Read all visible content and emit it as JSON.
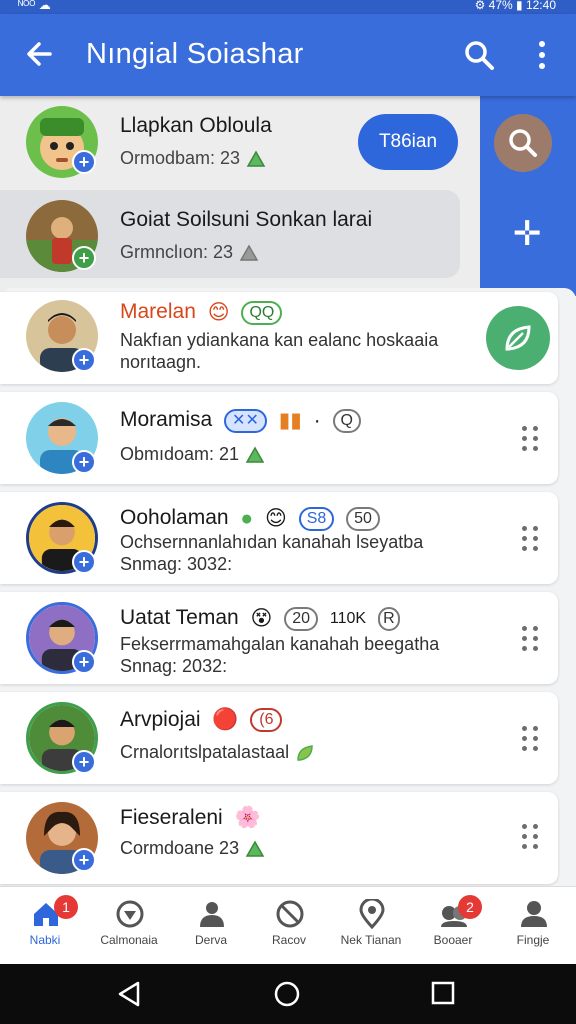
{
  "status_bar": {
    "left": "ᴺᴼᴼ ☁",
    "right": "⚙ 47% ▮ 12:40"
  },
  "app_bar": {
    "title": "Nıngial Soiashar"
  },
  "top_items": [
    {
      "name": "Llapkan Obloula",
      "sub": "Ormodbam: 23",
      "action": "T86ian"
    },
    {
      "name": "Goiat Soilsuni Sonkan larai",
      "sub": "Grmnclıon: 23"
    }
  ],
  "cards": [
    {
      "name": "Marelan",
      "line1": "Nakfıan ydiankana kan ealanc hoskaaia",
      "line2": "norıtaagn.",
      "tags": [
        "😊",
        "QQ"
      ]
    },
    {
      "name": "Moramisa",
      "line1": "Obmıdoam: 21",
      "tags": [
        "✕✕",
        "▮▮",
        "·",
        "Q"
      ]
    },
    {
      "name": "Ooholaman",
      "line1": "Ochsernnanlahıdan kanahah lseyatba",
      "line2": "Snmag: 3032:",
      "tags": [
        "●",
        "😊",
        "S8",
        "50"
      ]
    },
    {
      "name": "Uatat Teman",
      "line1": "Fekserrmamahgalan kanahah beegatha",
      "line2": "Snnag: 2032:",
      "tags": [
        "😵",
        "20",
        "110K",
        "R"
      ]
    },
    {
      "name": "Arvpiojai",
      "line1": "Crnalorıtslpatalastaal",
      "tags": [
        "🔴",
        "(6"
      ]
    },
    {
      "name": "Fieseraleni",
      "line1": "Cormdoane 23",
      "tags": [
        "🌸"
      ]
    }
  ],
  "bottom_nav": [
    {
      "label": "Nabki",
      "icon": "home-icon",
      "badge": "1"
    },
    {
      "label": "Calmonaia",
      "icon": "shield-icon"
    },
    {
      "label": "Derva",
      "icon": "person-icon"
    },
    {
      "label": "Racov",
      "icon": "block-icon"
    },
    {
      "label": "Nek Tianan",
      "icon": "location-icon"
    },
    {
      "label": "Booaer",
      "icon": "group-icon",
      "badge": "2"
    },
    {
      "label": "Fingje",
      "icon": "profile-icon"
    }
  ],
  "colors": {
    "primary": "#3a6ddc",
    "accent": "#2e66dc",
    "fab": "#4caf72",
    "badge": "#e53935"
  }
}
